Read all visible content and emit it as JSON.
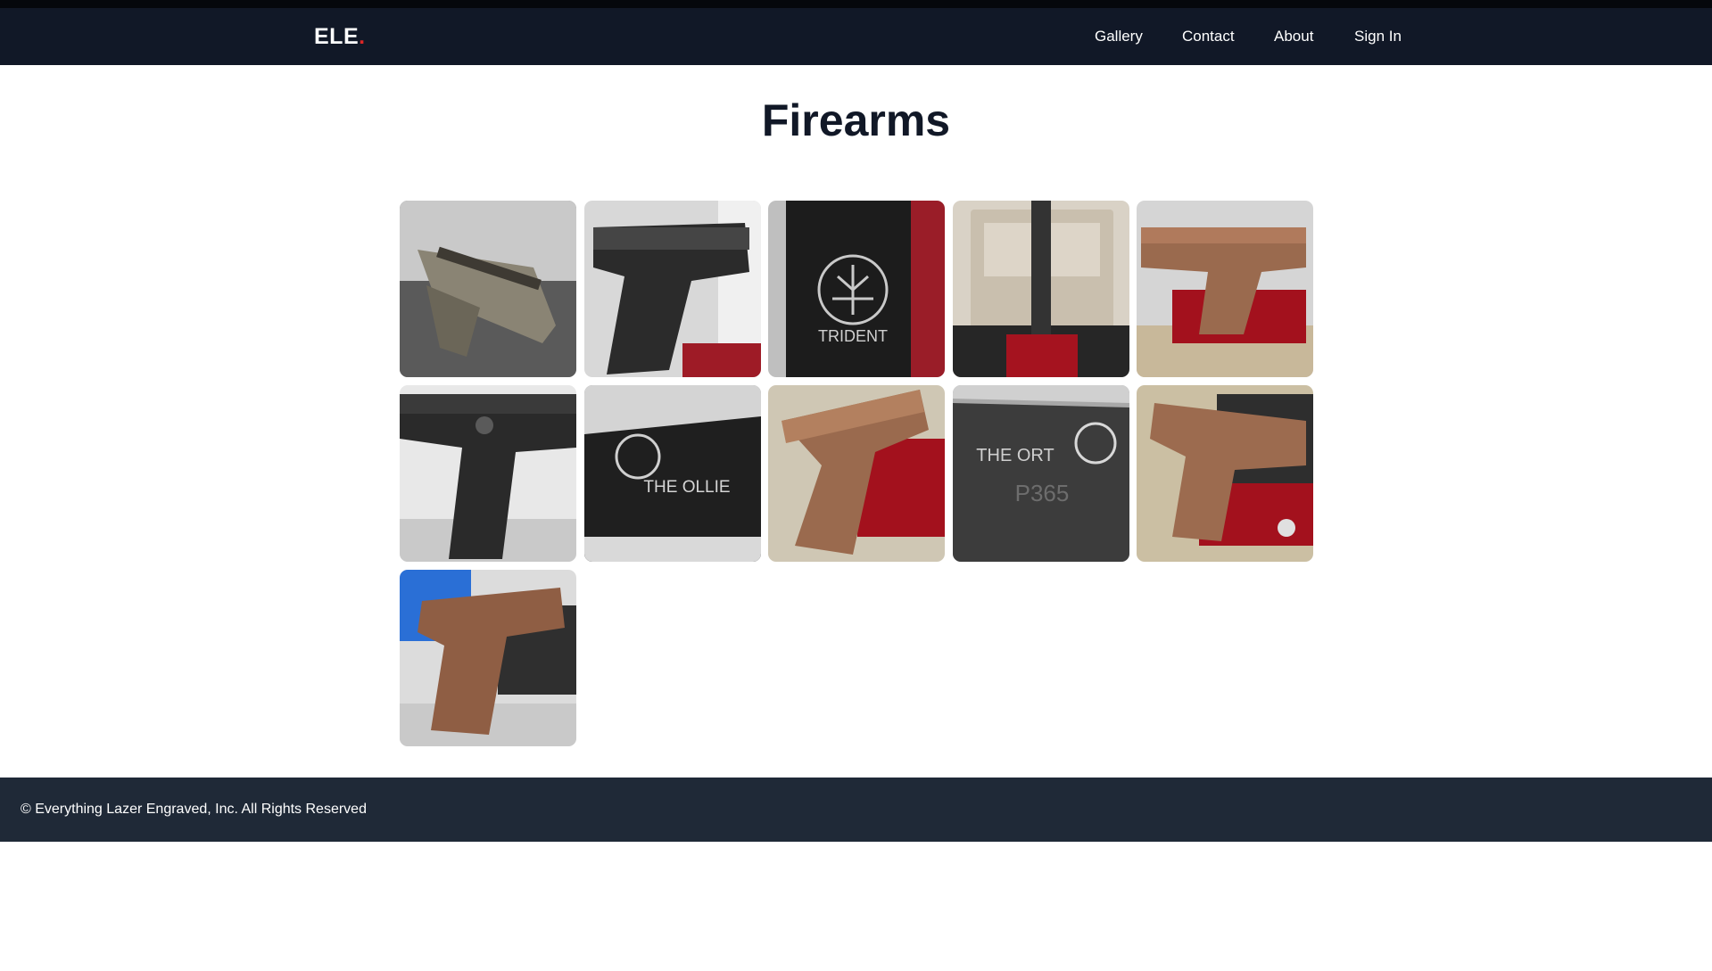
{
  "brand": {
    "name": "ELE",
    "dot": "."
  },
  "nav": {
    "gallery": "Gallery",
    "contact": "Contact",
    "about": "About",
    "sign_in": "Sign In"
  },
  "page": {
    "title": "Firearms"
  },
  "gallery": {
    "images": [
      {
        "subject": "engraved pistol on slate background"
      },
      {
        "subject": "black engraved pistol in red vise"
      },
      {
        "subject": "slide engraved with Trident logo",
        "text": "TRIDENT"
      },
      {
        "subject": "slide with flag engraving in vise"
      },
      {
        "subject": "copper engraved pistol on laser bed"
      },
      {
        "subject": "black pistol with engraved slide"
      },
      {
        "subject": "slide engraved The Ollie",
        "text": "THE OLLIE"
      },
      {
        "subject": "copper engraved pistol in red vise"
      },
      {
        "subject": "P365 slide engraved The Ort",
        "text": "THE ORT",
        "text2": "P365"
      },
      {
        "subject": "copper pistol frame on laser bed"
      },
      {
        "subject": "copper engraved pistol on workbench"
      }
    ]
  },
  "footer": {
    "copyright": "© Everything Lazer Engraved, Inc. All Rights Reserved"
  },
  "colors": {
    "navbar": "#111827",
    "footer": "#1f2937",
    "brand_dot": "#dc2626"
  }
}
